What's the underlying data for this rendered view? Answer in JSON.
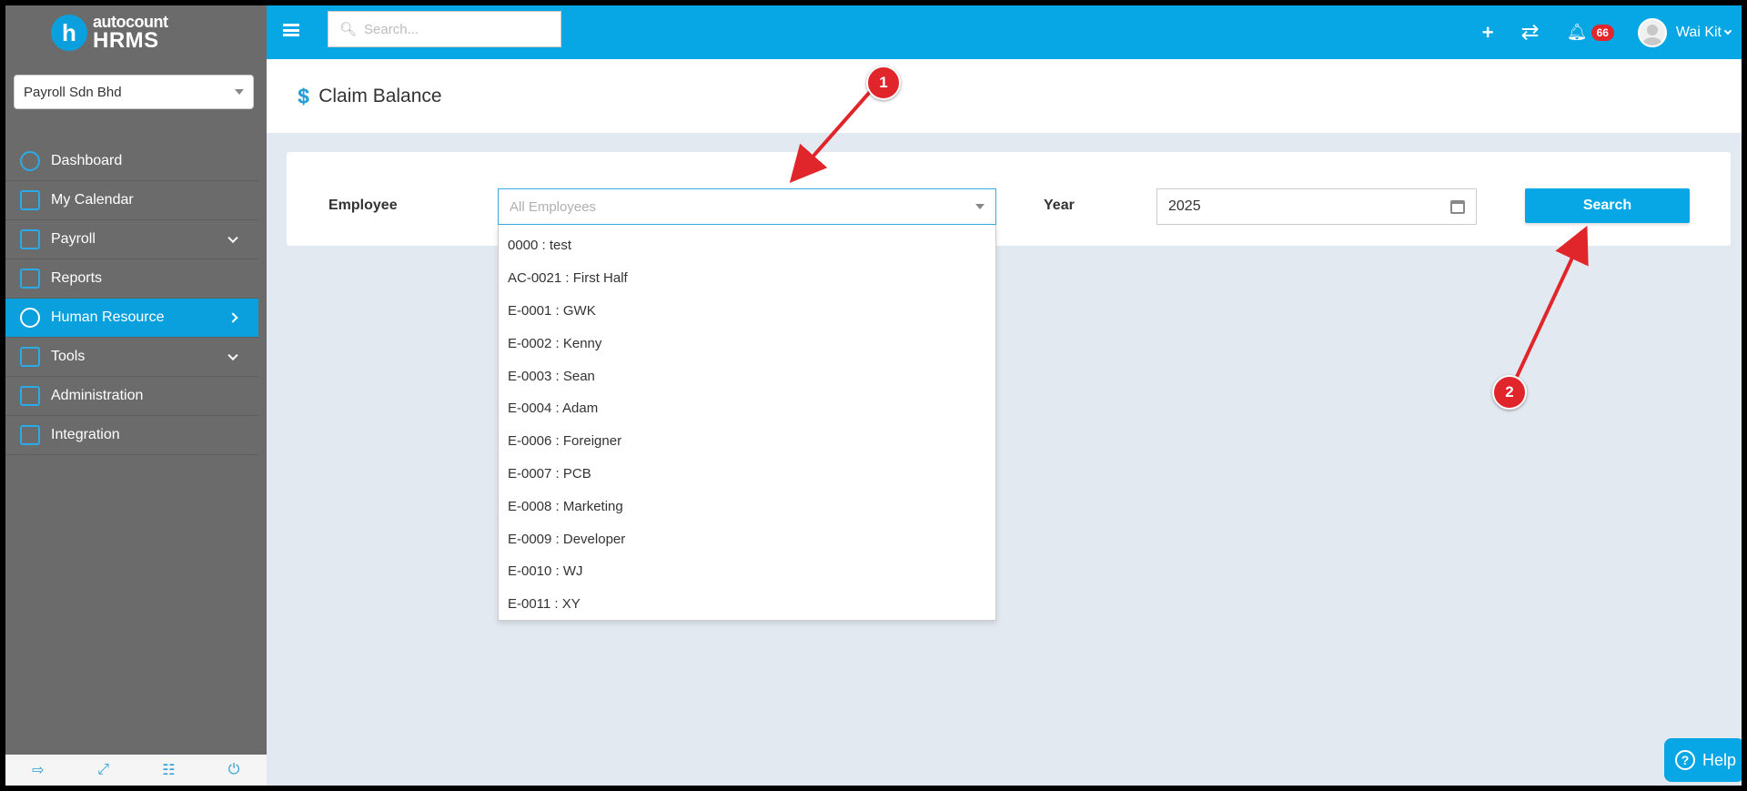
{
  "app": {
    "logo_top": "autocount",
    "logo_bottom": "HRMS",
    "logo_letter": "h"
  },
  "company": {
    "selected": "Payroll Sdn Bhd"
  },
  "sidebar": {
    "items": [
      {
        "label": "Dashboard",
        "icon": "dashboard-icon"
      },
      {
        "label": "My Calendar",
        "icon": "calendar-icon"
      },
      {
        "label": "Payroll",
        "icon": "payroll-icon",
        "has_children": true
      },
      {
        "label": "Reports",
        "icon": "reports-icon"
      },
      {
        "label": "Human Resource",
        "icon": "human-resource-icon",
        "active": true
      },
      {
        "label": "Tools",
        "icon": "tools-icon",
        "has_children": true
      },
      {
        "label": "Administration",
        "icon": "administration-icon"
      },
      {
        "label": "Integration",
        "icon": "integration-icon"
      }
    ]
  },
  "topbar": {
    "search_placeholder": "Search...",
    "notification_count": "66",
    "user_name": "Wai Kit"
  },
  "page": {
    "title": "Claim Balance"
  },
  "filter": {
    "employee_label": "Employee",
    "employee_placeholder": "All Employees",
    "year_label": "Year",
    "year_value": "2025",
    "search_button": "Search"
  },
  "employee_options": [
    "0000 : test",
    "AC-0021 : First Half",
    "E-0001 : GWK",
    "E-0002 : Kenny",
    "E-0003 : Sean",
    "E-0004 : Adam",
    "E-0006 : Foreigner",
    "E-0007 : PCB",
    "E-0008 : Marketing",
    "E-0009 : Developer",
    "E-0010 : WJ",
    "E-0011 : XY"
  ],
  "annotations": {
    "marker1": "1",
    "marker2": "2"
  },
  "help": {
    "label": "Help"
  },
  "colors": {
    "accent": "#07a6e4",
    "sidebar": "#6b6b6b",
    "marker": "#e0262b"
  }
}
